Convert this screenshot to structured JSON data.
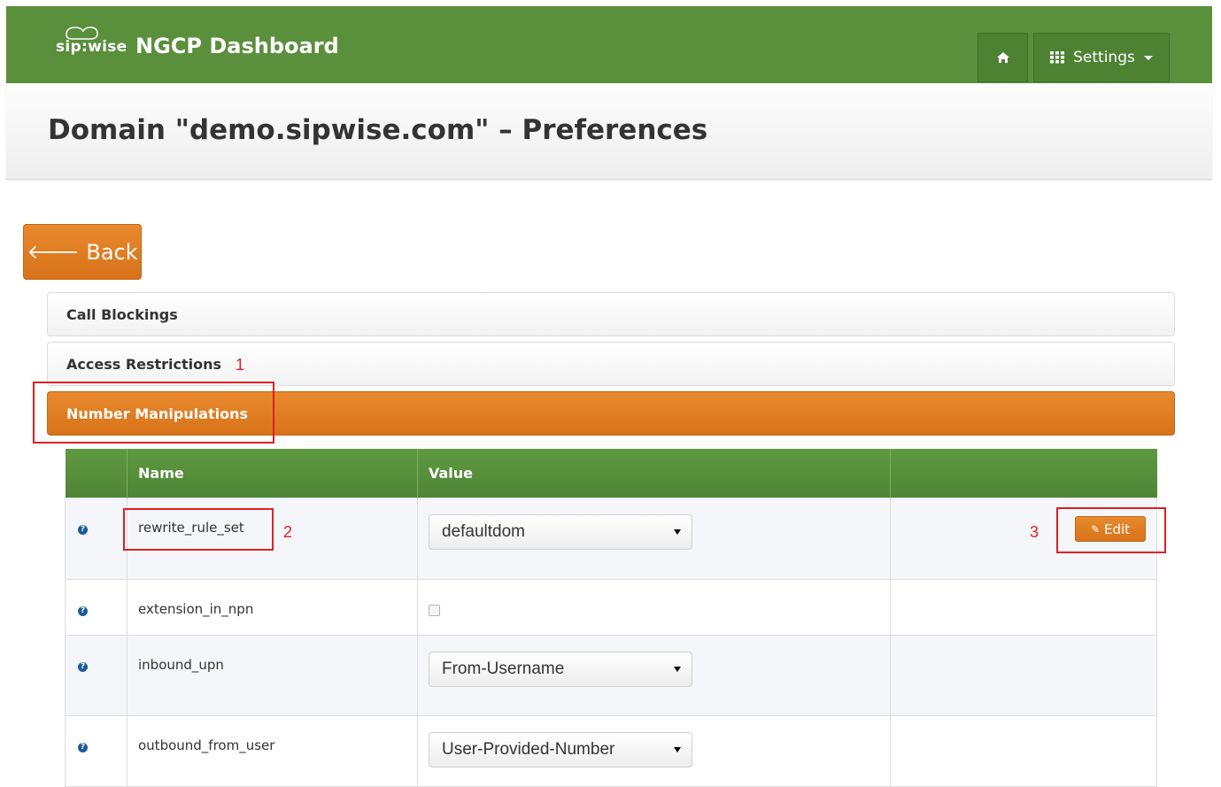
{
  "navbar": {
    "logo_text": "sip:wise",
    "title": "NGCP Dashboard",
    "home_icon": "home-icon",
    "settings_label": "Settings",
    "settings_icon": "grid-icon"
  },
  "page": {
    "title": "Domain \"demo.sipwise.com\" – Preferences"
  },
  "back_button": {
    "label": "Back",
    "icon": "arrow-left-icon"
  },
  "accordion": [
    {
      "label": "Call Blockings",
      "active": false
    },
    {
      "label": "Access Restrictions",
      "active": false
    },
    {
      "label": "Number Manipulations",
      "active": true
    }
  ],
  "table": {
    "headers": [
      "",
      "Name",
      "Value",
      ""
    ],
    "rows": [
      {
        "name": "rewrite_rule_set",
        "type": "select",
        "value": "defaultdom",
        "has_edit": true
      },
      {
        "name": "extension_in_npn",
        "type": "checkbox",
        "checked": false
      },
      {
        "name": "inbound_upn",
        "type": "select",
        "value": "From-Username"
      },
      {
        "name": "outbound_from_user",
        "type": "select",
        "value": "User-Provided-Number"
      }
    ]
  },
  "edit_button": {
    "label": "Edit"
  },
  "annotations": [
    "1",
    "2",
    "3"
  ],
  "colors": {
    "navbar": "#5a8f3c",
    "accent_orange": "#e07f24",
    "table_header": "#5a8f3c",
    "annotation_red": "#e02020",
    "help_icon": "#1c5b9e"
  }
}
